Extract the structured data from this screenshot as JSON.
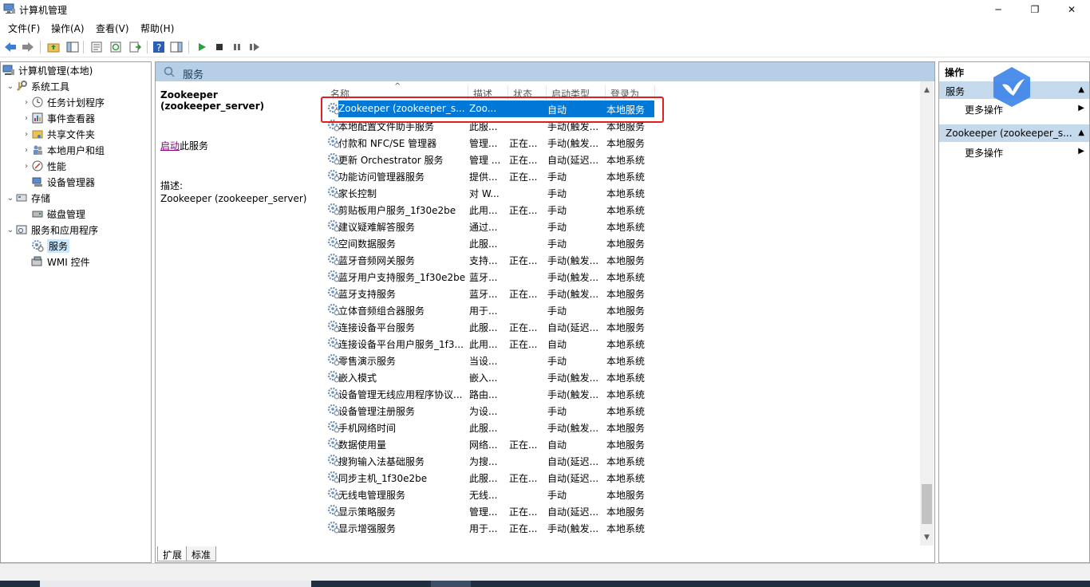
{
  "window": {
    "title": "计算机管理",
    "minimize": "─",
    "maximize": "❐",
    "close": "✕"
  },
  "menu": {
    "file": "文件(F)",
    "action": "操作(A)",
    "view": "查看(V)",
    "help": "帮助(H)"
  },
  "tree": {
    "root": "计算机管理(本地)",
    "system_tools": "系统工具",
    "task_scheduler": "任务计划程序",
    "event_viewer": "事件查看器",
    "shared_folders": "共享文件夹",
    "local_users": "本地用户和组",
    "performance": "性能",
    "device_manager": "设备管理器",
    "storage": "存储",
    "disk_management": "磁盘管理",
    "services_apps": "服务和应用程序",
    "services": "服务",
    "wmi": "WMI 控件"
  },
  "center": {
    "header_title": "服务",
    "selected_name": "Zookeeper (zookeeper_server)",
    "start_link": "启动",
    "start_suffix": "此服务",
    "desc_label": "描述:",
    "desc_text": "Zookeeper (zookeeper_server)",
    "columns": {
      "name": "名称",
      "description": "描述",
      "status": "状态",
      "startup": "启动类型",
      "logon": "登录为"
    },
    "tabs": {
      "extended": "扩展",
      "standard": "标准"
    }
  },
  "services": [
    {
      "name": "Zookeeper (zookeeper_s...",
      "desc": "Zoo...",
      "status": "",
      "startup": "自动",
      "logon": "本地服务",
      "selected": true
    },
    {
      "name": "本地配置文件助手服务",
      "desc": "此服...",
      "status": "",
      "startup": "手动(触发...",
      "logon": "本地服务"
    },
    {
      "name": "付款和 NFC/SE 管理器",
      "desc": "管理...",
      "status": "正在...",
      "startup": "手动(触发...",
      "logon": "本地服务"
    },
    {
      "name": "更新 Orchestrator 服务",
      "desc": "管理 ...",
      "status": "正在...",
      "startup": "自动(延迟...",
      "logon": "本地系统"
    },
    {
      "name": "功能访问管理器服务",
      "desc": "提供...",
      "status": "正在...",
      "startup": "手动",
      "logon": "本地系统"
    },
    {
      "name": "家长控制",
      "desc": "对 W...",
      "status": "",
      "startup": "手动",
      "logon": "本地系统"
    },
    {
      "name": "剪贴板用户服务_1f30e2be",
      "desc": "此用...",
      "status": "正在...",
      "startup": "手动",
      "logon": "本地系统"
    },
    {
      "name": "建议疑难解答服务",
      "desc": "通过...",
      "status": "",
      "startup": "手动",
      "logon": "本地系统"
    },
    {
      "name": "空间数据服务",
      "desc": "此服...",
      "status": "",
      "startup": "手动",
      "logon": "本地服务"
    },
    {
      "name": "蓝牙音频网关服务",
      "desc": "支持...",
      "status": "正在...",
      "startup": "手动(触发...",
      "logon": "本地服务"
    },
    {
      "name": "蓝牙用户支持服务_1f30e2be",
      "desc": "蓝牙...",
      "status": "",
      "startup": "手动(触发...",
      "logon": "本地系统"
    },
    {
      "name": "蓝牙支持服务",
      "desc": "蓝牙...",
      "status": "正在...",
      "startup": "手动(触发...",
      "logon": "本地服务"
    },
    {
      "name": "立体音频组合器服务",
      "desc": "用于...",
      "status": "",
      "startup": "手动",
      "logon": "本地服务"
    },
    {
      "name": "连接设备平台服务",
      "desc": "此服...",
      "status": "正在...",
      "startup": "自动(延迟...",
      "logon": "本地服务"
    },
    {
      "name": "连接设备平台用户服务_1f3...",
      "desc": "此用...",
      "status": "正在...",
      "startup": "自动",
      "logon": "本地系统"
    },
    {
      "name": "零售演示服务",
      "desc": "当设...",
      "status": "",
      "startup": "手动",
      "logon": "本地系统"
    },
    {
      "name": "嵌入模式",
      "desc": "嵌入...",
      "status": "",
      "startup": "手动(触发...",
      "logon": "本地系统"
    },
    {
      "name": "设备管理无线应用程序协议...",
      "desc": "路由...",
      "status": "",
      "startup": "手动(触发...",
      "logon": "本地系统"
    },
    {
      "name": "设备管理注册服务",
      "desc": "为设...",
      "status": "",
      "startup": "手动",
      "logon": "本地系统"
    },
    {
      "name": "手机网络时间",
      "desc": "此服...",
      "status": "",
      "startup": "手动(触发...",
      "logon": "本地服务"
    },
    {
      "name": "数据使用量",
      "desc": "网络...",
      "status": "正在...",
      "startup": "自动",
      "logon": "本地服务"
    },
    {
      "name": "搜狗输入法基础服务",
      "desc": "为搜...",
      "status": "",
      "startup": "自动(延迟...",
      "logon": "本地系统"
    },
    {
      "name": "同步主机_1f30e2be",
      "desc": "此服...",
      "status": "正在...",
      "startup": "自动(延迟...",
      "logon": "本地系统"
    },
    {
      "name": "无线电管理服务",
      "desc": "无线...",
      "status": "",
      "startup": "手动",
      "logon": "本地服务"
    },
    {
      "name": "显示策略服务",
      "desc": "管理...",
      "status": "正在...",
      "startup": "自动(延迟...",
      "logon": "本地服务"
    },
    {
      "name": "显示增强服务",
      "desc": "用于...",
      "status": "正在...",
      "startup": "手动(触发...",
      "logon": "本地系统"
    }
  ],
  "actions": {
    "header": "操作",
    "section1": "服务",
    "more1": "更多操作",
    "section2": "Zookeeper (zookeeper_s...",
    "more2": "更多操作"
  },
  "colors": {
    "selection": "#0078d7",
    "highlight_box": "#e02020",
    "header_band": "#b6cfe6"
  }
}
